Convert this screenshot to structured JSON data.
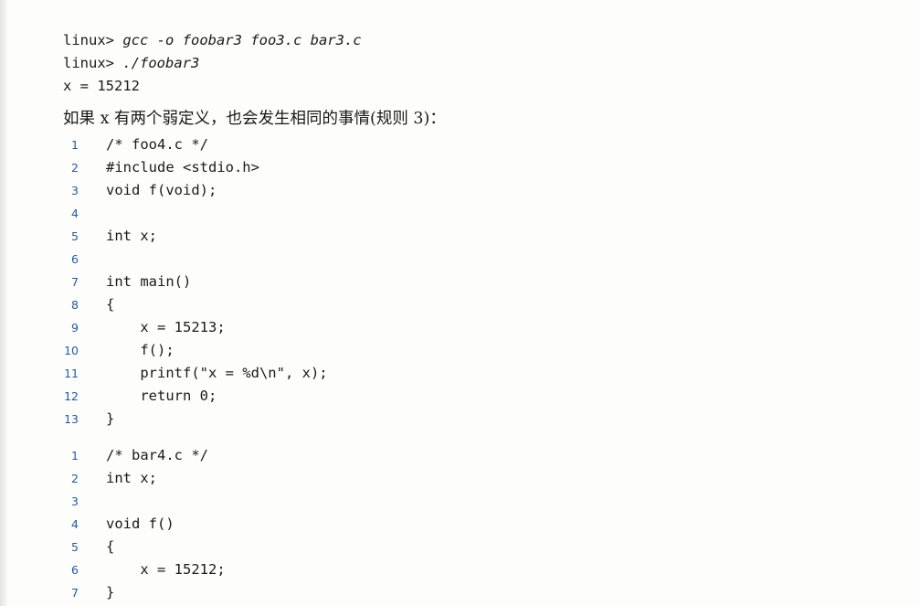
{
  "terminal": {
    "lines": [
      {
        "prompt": "linux> ",
        "command": "gcc -o foobar3 foo3.c bar3.c"
      },
      {
        "prompt": "linux> ",
        "command": "./foobar3"
      },
      {
        "prompt": "",
        "command": "",
        "output": "x = 15212"
      }
    ]
  },
  "paragraph": "如果 x 有两个弱定义，也会发生相同的事情(规则 3)：",
  "listings": {
    "foo4": {
      "lines": [
        {
          "no": "1",
          "code": "/* foo4.c */"
        },
        {
          "no": "2",
          "code": "#include <stdio.h>"
        },
        {
          "no": "3",
          "code": "void f(void);"
        },
        {
          "no": "4",
          "code": ""
        },
        {
          "no": "5",
          "code": "int x;"
        },
        {
          "no": "6",
          "code": ""
        },
        {
          "no": "7",
          "code": "int main()"
        },
        {
          "no": "8",
          "code": "{"
        },
        {
          "no": "9",
          "code": "    x = 15213;"
        },
        {
          "no": "10",
          "code": "    f();"
        },
        {
          "no": "11",
          "code": "    printf(\"x = %d\\n\", x);"
        },
        {
          "no": "12",
          "code": "    return 0;"
        },
        {
          "no": "13",
          "code": "}"
        }
      ]
    },
    "bar4": {
      "lines": [
        {
          "no": "1",
          "code": "/* bar4.c */"
        },
        {
          "no": "2",
          "code": "int x;"
        },
        {
          "no": "3",
          "code": ""
        },
        {
          "no": "4",
          "code": "void f()"
        },
        {
          "no": "5",
          "code": "{"
        },
        {
          "no": "6",
          "code": "    x = 15212;"
        },
        {
          "no": "7",
          "code": "}"
        }
      ]
    }
  },
  "colors": {
    "line_number": "#1e5aa8",
    "text": "#1a1a1a",
    "background": "#fdfdfc"
  }
}
